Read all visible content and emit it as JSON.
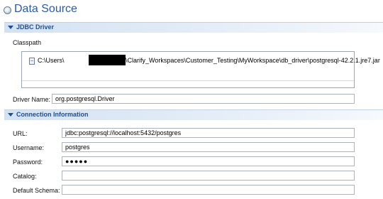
{
  "page": {
    "title": "Data Source",
    "title_icon": "database-circle-icon"
  },
  "jdbc_section": {
    "header": "JDBC Driver",
    "classpath_label": "Classpath",
    "classpath_entry_prefix": "C:\\Users\\",
    "classpath_entry_suffix": "\\Clarify_Workspaces\\Customer_Testing\\MyWorkspace\\db_driver\\postgresql-42.2.1.jre7.jar",
    "driver_name_label": "Driver Name:",
    "driver_name_value": "org.postgresql.Driver"
  },
  "connection_section": {
    "header": "Connection Information",
    "url_label": "URL:",
    "url_value": "jdbc:postgresql://localhost:5432/postgres",
    "username_label": "Username:",
    "username_value": "postgres",
    "password_label": "Password:",
    "password_value": "●●●●●",
    "catalog_label": "Catalog:",
    "catalog_value": "",
    "default_schema_label": "Default Schema:",
    "default_schema_value": ""
  },
  "colors": {
    "title": "#2b5aa6",
    "section_header_text": "#1f4f94",
    "section_header_bg": "#d3e2f2"
  }
}
